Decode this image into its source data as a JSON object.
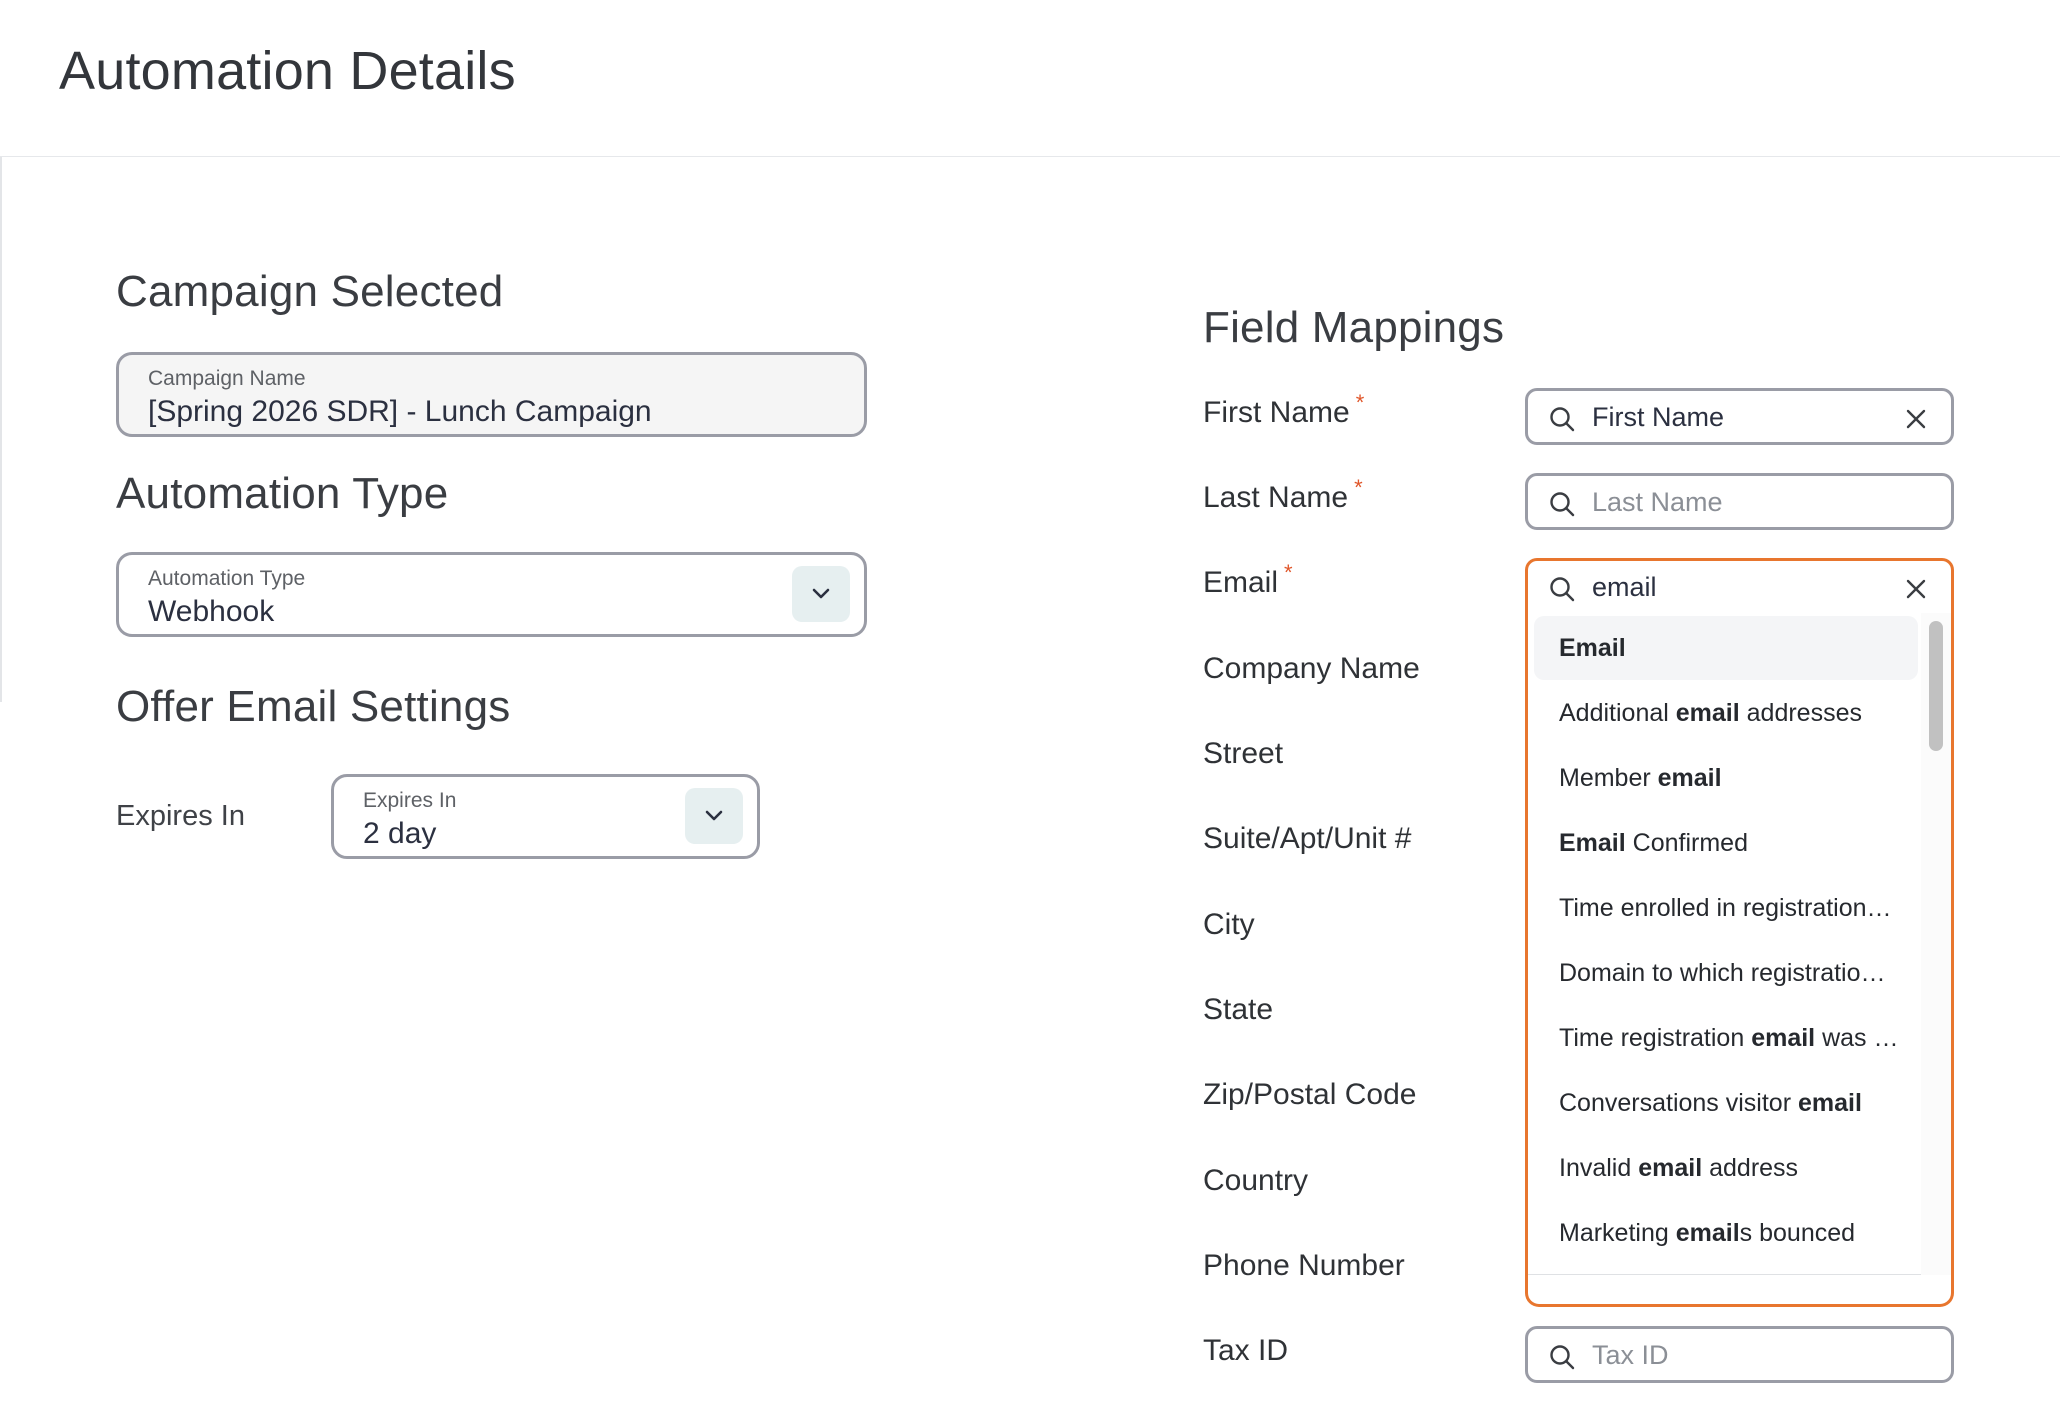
{
  "header": {
    "title": "Automation Details"
  },
  "campaign": {
    "section_title": "Campaign Selected",
    "field_label": "Campaign Name",
    "field_value": "[Spring 2026 SDR] - Lunch Campaign"
  },
  "automation": {
    "section_title": "Automation Type",
    "field_label": "Automation Type",
    "field_value": "Webhook"
  },
  "offer_email": {
    "section_title": "Offer Email Settings",
    "expires_label": "Expires In",
    "field_label": "Expires In",
    "field_value": "2 day"
  },
  "field_mappings": {
    "section_title": "Field Mappings",
    "required_marker": "*",
    "rows": [
      {
        "label": "First Name",
        "required": true,
        "value": "First Name"
      },
      {
        "label": "Last Name",
        "required": true,
        "placeholder": "Last Name"
      },
      {
        "label": "Email",
        "required": true,
        "value": "email"
      },
      {
        "label": "Company Name"
      },
      {
        "label": "Street"
      },
      {
        "label": "Suite/Apt/Unit #"
      },
      {
        "label": "City"
      },
      {
        "label": "State"
      },
      {
        "label": "Zip/Postal Code"
      },
      {
        "label": "Country"
      },
      {
        "label": "Phone Number"
      },
      {
        "label": "Tax ID",
        "placeholder": "Tax ID"
      }
    ]
  },
  "email_dropdown": {
    "options": [
      {
        "pre": "",
        "match": "Email",
        "post": ""
      },
      {
        "pre": "Additional ",
        "match": "email",
        "post": " addresses"
      },
      {
        "pre": "Member ",
        "match": "email",
        "post": ""
      },
      {
        "pre": "",
        "match": "Email",
        "post": " Confirmed"
      },
      {
        "pre": "Time enrolled in registration…",
        "match": "",
        "post": ""
      },
      {
        "pre": "Domain to which registratio…",
        "match": "",
        "post": ""
      },
      {
        "pre": "Time registration ",
        "match": "email",
        "post": " was …"
      },
      {
        "pre": "Conversations visitor ",
        "match": "email",
        "post": ""
      },
      {
        "pre": "Invalid ",
        "match": "email",
        "post": " address"
      },
      {
        "pre": "Marketing ",
        "match": "email",
        "post": "s bounced"
      }
    ]
  },
  "colors": {
    "accent": "#e8762e",
    "required": "#e0562a",
    "border": "#9a9ca6"
  }
}
